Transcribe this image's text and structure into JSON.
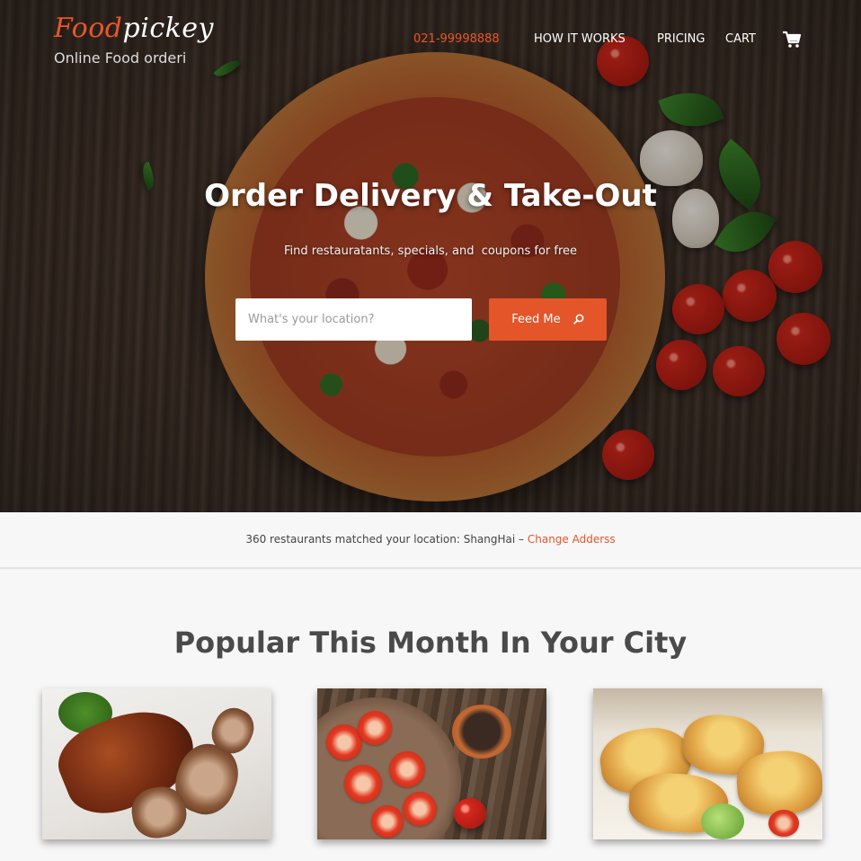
{
  "header": {
    "logo_accent": "Food",
    "logo_rest": "pickey",
    "tagline": "Online Food ordering",
    "nav": {
      "phone": "021-99998888",
      "how_it_works": "HOW IT WORKS",
      "pricing": "PRICING",
      "cart": "CART",
      "cart_icon": "shopping-cart-icon"
    }
  },
  "hero": {
    "title": "Order Delivery & Take-Out",
    "subtitle": "Find restauratants, specials, and  coupons for free",
    "search": {
      "placeholder": "What's your location?",
      "value": ""
    },
    "button_label": "Feed Me",
    "button_icon": "search-icon"
  },
  "match_bar": {
    "text": "360 restaurants matched your location: ShangHai – ",
    "link": "Change Adderss"
  },
  "popular": {
    "title": "Popular This Month In Your City"
  },
  "colors": {
    "accent": "#e4552a",
    "background": "#f7f7f7",
    "text": "#444444"
  }
}
